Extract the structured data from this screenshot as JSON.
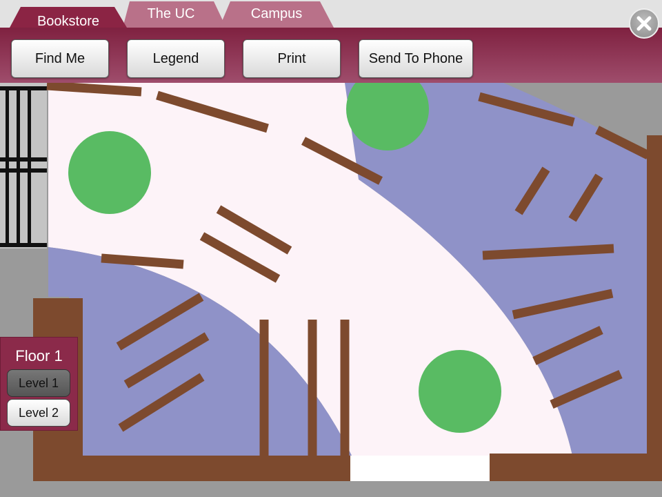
{
  "tabs": [
    {
      "label": "Bookstore",
      "active": true
    },
    {
      "label": "The UC",
      "active": false
    },
    {
      "label": "Campus",
      "active": false
    }
  ],
  "toolbar": {
    "find_me": "Find Me",
    "legend": "Legend",
    "print": "Print",
    "send_to_phone": "Send To Phone",
    "close_icon": "close-x-icon"
  },
  "floor_panel": {
    "title": "Floor 1",
    "levels": [
      {
        "label": "Level 1",
        "selected": true
      },
      {
        "label": "Level 2",
        "selected": false
      }
    ]
  },
  "colors": {
    "header": "#8b2a4a",
    "walkway": "#fdf3f8",
    "zone": "#8f92c8",
    "shelf": "#7d4a2e",
    "table": "#59bb63"
  }
}
